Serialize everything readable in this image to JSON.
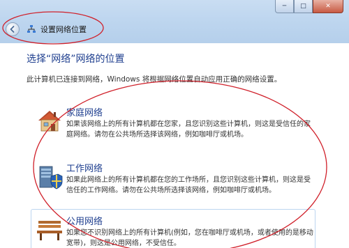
{
  "window": {
    "controls": {
      "minimize": "─",
      "maximize": "□",
      "close": "✕"
    }
  },
  "nav": {
    "title": "设置网络位置",
    "back_icon": "back-arrow-icon",
    "network_icon": "network-icon"
  },
  "page": {
    "title": "选择“网络”网络的位置",
    "intro": "此计算机已连接到网络，Windows 将根据网络位置自动应用正确的网络设置。"
  },
  "options": [
    {
      "title": "家庭网络",
      "icon": "house-icon",
      "description": "如果该网络上的所有计算机都在您家，且您识别这些计算机，则这是受信任的家庭网络。请勿在公共场所选择该网络，例如咖啡厅或机场。"
    },
    {
      "title": "工作网络",
      "icon": "work-computer-shield-icon",
      "description": "如果此网络上的所有计算机都在您的工作场所，且您识别这些计算机，则这是受信任的工作网络。请勿在公共场所选择该网络，例如咖啡厅或机场。"
    },
    {
      "title": "公用网络",
      "icon": "park-bench-icon",
      "description": "如果您不识别网络上的所有计算机(例如，您在咖啡厅或机场，或者使用的是移动宽带)，则这是公用网络，不受信任。"
    }
  ],
  "colors": {
    "annotation": "#d0202a",
    "heading": "#1f3f8f"
  }
}
